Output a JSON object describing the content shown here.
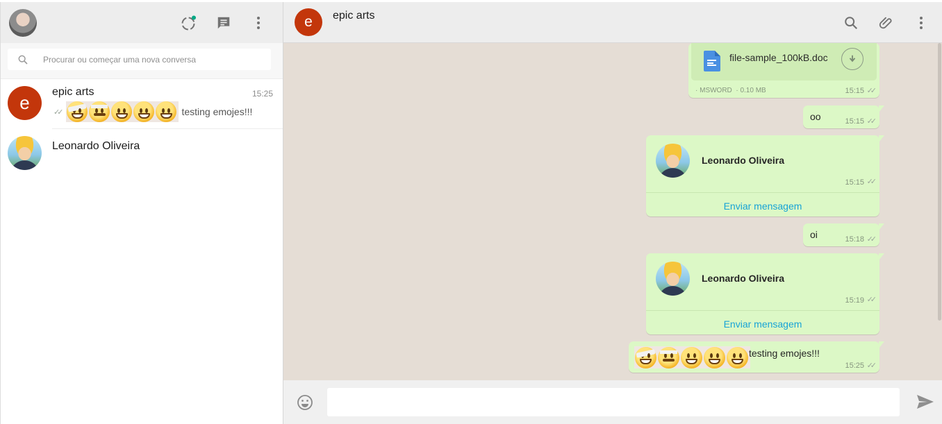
{
  "sidebar": {
    "search": {
      "placeholder": "Procurar ou começar uma nova conversa",
      "value": ""
    },
    "chats": [
      {
        "name": "epic arts",
        "avatar_letter": "e",
        "time": "15:25",
        "preview_text": "testing emojes!!!",
        "preview_ticks": "✓✓"
      },
      {
        "name": "Leonardo Oliveira"
      }
    ],
    "icons": [
      "status-icon",
      "new-chat-icon",
      "menu-icon"
    ]
  },
  "conversation": {
    "title": "epic arts",
    "avatar_letter": "e",
    "icons": [
      "search-icon",
      "attach-icon",
      "menu-icon"
    ],
    "messages": [
      {
        "type": "document",
        "filename": "file-sample_100kB.doc",
        "filetype": "MSWORD",
        "size": "0.10 MB",
        "time": "15:15",
        "ticks": "✓✓"
      },
      {
        "type": "text",
        "text": "oo",
        "time": "15:15",
        "ticks": "✓✓"
      },
      {
        "type": "contact",
        "name": "Leonardo Oliveira",
        "time": "15:15",
        "ticks": "✓✓",
        "action": "Enviar mensagem"
      },
      {
        "type": "text",
        "text": "oi",
        "time": "15:18",
        "ticks": "✓✓"
      },
      {
        "type": "contact",
        "name": "Leonardo Oliveira",
        "time": "15:19",
        "ticks": "✓✓",
        "action": "Enviar mensagem"
      },
      {
        "type": "emoji-text",
        "text": "testing emojes!!!",
        "time": "15:25",
        "ticks": "✓✓"
      }
    ]
  },
  "composer": {
    "value": "",
    "placeholder": ""
  },
  "colors": {
    "accent": "#00a884",
    "bubble_out": "#dcf8c6",
    "wallpaper": "#e5ddd5",
    "link": "#17a3d6",
    "avatar_e": "#c3360b"
  }
}
